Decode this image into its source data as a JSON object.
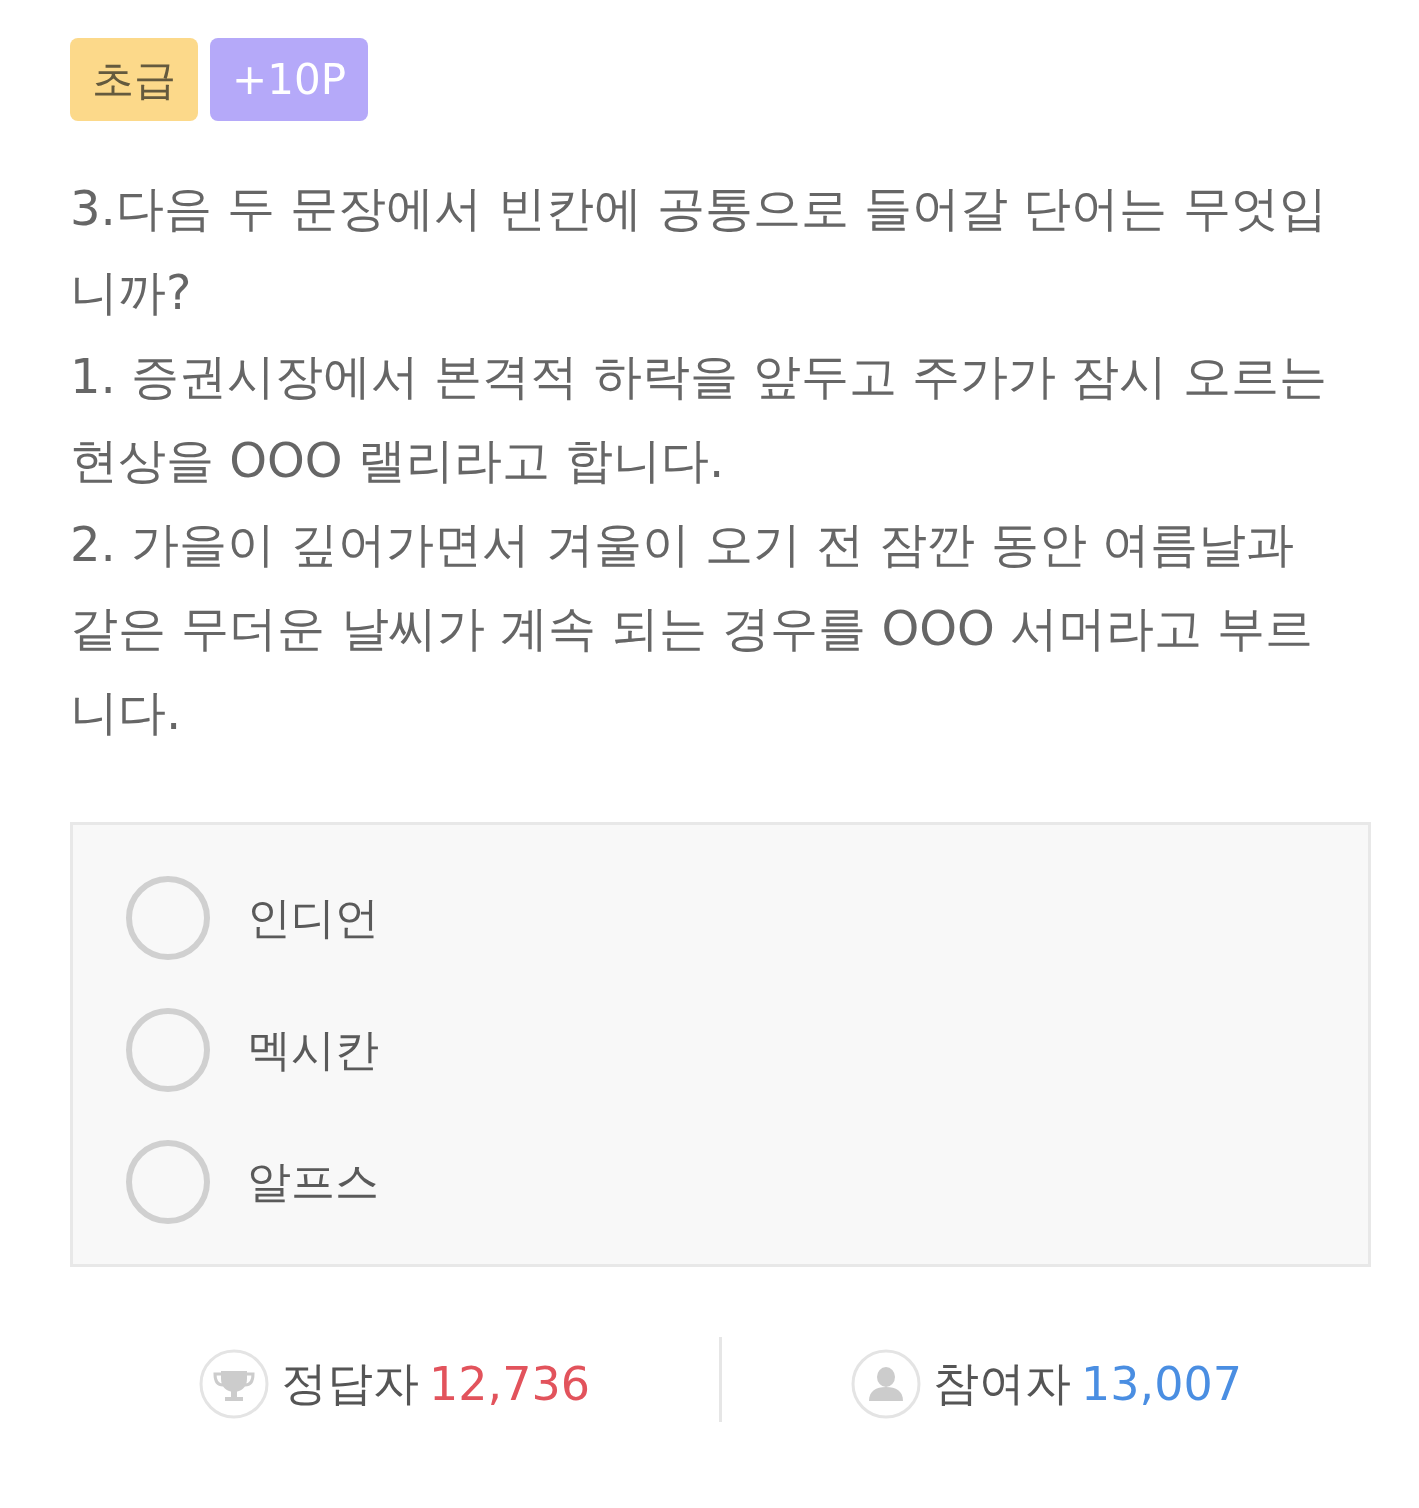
{
  "badges": [
    {
      "kind": "level",
      "label": "초급"
    },
    {
      "kind": "points",
      "label": "+10P"
    }
  ],
  "question": {
    "title": "3.다음 두 문장에서 빈칸에 공통으로 들어갈 단어는 무엇입니까?",
    "sentences": [
      "1. 증권시장에서 본격적 하락을 앞두고 주가가 잠시 오르는 현상을 OOO 랠리라고 합니다.",
      "2. 가을이 깊어가면서 겨울이 오기 전 잠깐 동안 여름날과 같은 무더운 날씨가 계속 되는 경우를 OOO 서머라고 부르니다."
    ]
  },
  "options": [
    {
      "label": "인디언",
      "selected": false
    },
    {
      "label": "멕시칸",
      "selected": false
    },
    {
      "label": "알프스",
      "selected": false
    }
  ],
  "stats": [
    {
      "kind": "correct",
      "label": "정답자",
      "count": "12,736"
    },
    {
      "kind": "participants",
      "label": "참여자",
      "count": "13,007"
    }
  ]
}
